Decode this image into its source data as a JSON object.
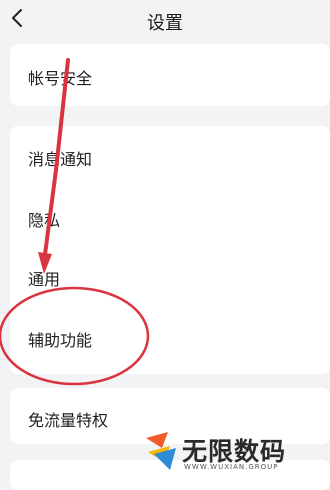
{
  "header": {
    "title": "设置",
    "back_icon": "chevron-left-icon"
  },
  "menu": {
    "account_security": "帐号安全",
    "notifications": "消息通知",
    "privacy": "隐私",
    "general": "通用",
    "accessibility": "辅助功能",
    "free_data": "免流量特权"
  },
  "annotation": {
    "color": "#d9343f",
    "shapes": [
      "arrow",
      "ellipse"
    ]
  },
  "watermark": {
    "name": "无限数码",
    "url": "WWW.WUXIAN.GROUP"
  }
}
